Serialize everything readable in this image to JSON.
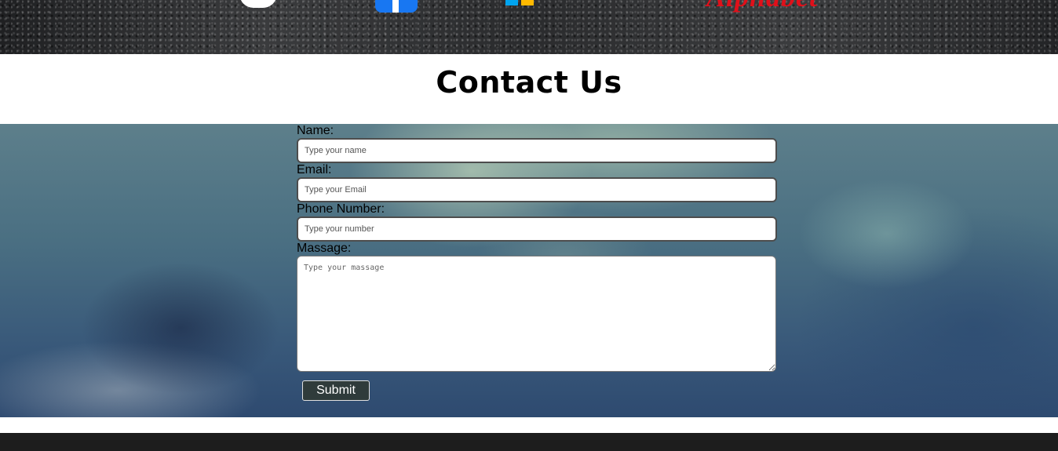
{
  "header": {
    "logos": [
      {
        "name": "apple-logo",
        "color": "#ffffff"
      },
      {
        "name": "facebook-logo",
        "color": "#1877f2"
      },
      {
        "name": "microsoft-logo",
        "colors": [
          "#00a4ef",
          "#ffb900"
        ]
      },
      {
        "name": "alphabet-logo",
        "color": "#e0101a",
        "text": "Alphabet"
      }
    ]
  },
  "page": {
    "title": "Contact Us"
  },
  "form": {
    "name_label": "Name:",
    "name_placeholder": "Type your name",
    "email_label": "Email:",
    "email_placeholder": "Type your Email",
    "phone_label": "Phone Number:",
    "phone_placeholder": "Type your number",
    "message_label": "Massage:",
    "message_placeholder": "Type your massage",
    "submit_label": "Submit"
  },
  "colors": {
    "title": "#000000",
    "submit_background": "#2f3b3b",
    "footer_background": "#1d1d1d"
  }
}
